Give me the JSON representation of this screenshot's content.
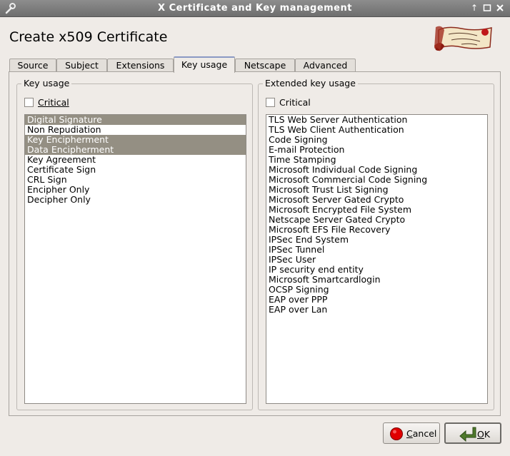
{
  "window": {
    "title": "X Certificate and Key management"
  },
  "heading": "Create x509 Certificate",
  "tabs": [
    {
      "label": "Source",
      "active": false
    },
    {
      "label": "Subject",
      "active": false
    },
    {
      "label": "Extensions",
      "active": false
    },
    {
      "label": "Key usage",
      "active": true
    },
    {
      "label": "Netscape",
      "active": false
    },
    {
      "label": "Advanced",
      "active": false
    }
  ],
  "key_usage": {
    "group_title": "Key usage",
    "critical_label": "Critical",
    "critical_checked": false,
    "items": [
      {
        "label": "Digital Signature",
        "selected": true
      },
      {
        "label": "Non Repudiation",
        "selected": false
      },
      {
        "label": "Key Encipherment",
        "selected": true
      },
      {
        "label": "Data Encipherment",
        "selected": true
      },
      {
        "label": "Key Agreement",
        "selected": false
      },
      {
        "label": "Certificate Sign",
        "selected": false
      },
      {
        "label": "CRL Sign",
        "selected": false
      },
      {
        "label": "Encipher Only",
        "selected": false
      },
      {
        "label": "Decipher Only",
        "selected": false
      }
    ]
  },
  "extended_key_usage": {
    "group_title": "Extended key usage",
    "critical_label": "Critical",
    "critical_checked": false,
    "items": [
      {
        "label": "TLS Web Server Authentication",
        "selected": false
      },
      {
        "label": "TLS Web Client Authentication",
        "selected": false
      },
      {
        "label": "Code Signing",
        "selected": false
      },
      {
        "label": "E-mail Protection",
        "selected": false
      },
      {
        "label": "Time Stamping",
        "selected": false
      },
      {
        "label": "Microsoft Individual Code Signing",
        "selected": false
      },
      {
        "label": "Microsoft Commercial Code Signing",
        "selected": false
      },
      {
        "label": "Microsoft Trust List Signing",
        "selected": false
      },
      {
        "label": "Microsoft Server Gated Crypto",
        "selected": false
      },
      {
        "label": "Microsoft Encrypted File System",
        "selected": false
      },
      {
        "label": "Netscape Server Gated Crypto",
        "selected": false
      },
      {
        "label": "Microsoft EFS File Recovery",
        "selected": false
      },
      {
        "label": "IPSec End System",
        "selected": false
      },
      {
        "label": "IPSec Tunnel",
        "selected": false
      },
      {
        "label": "IPSec User",
        "selected": false
      },
      {
        "label": "IP security end entity",
        "selected": false
      },
      {
        "label": "Microsoft Smartcardlogin",
        "selected": false
      },
      {
        "label": "OCSP Signing",
        "selected": false
      },
      {
        "label": "EAP over PPP",
        "selected": false
      },
      {
        "label": "EAP over Lan",
        "selected": false
      }
    ]
  },
  "buttons": {
    "cancel_label": "Cancel",
    "ok_label": "OK"
  },
  "icons": {
    "window": "wrench-icon",
    "cancel": "stop-circle-icon",
    "ok": "arrow-return-icon",
    "logo": "scroll-logo-icon"
  },
  "colors": {
    "selection": "#948f83",
    "titlebar": "#7d7d7d",
    "cancel_icon": "#e00000",
    "ok_icon": "#4f7a2c"
  }
}
